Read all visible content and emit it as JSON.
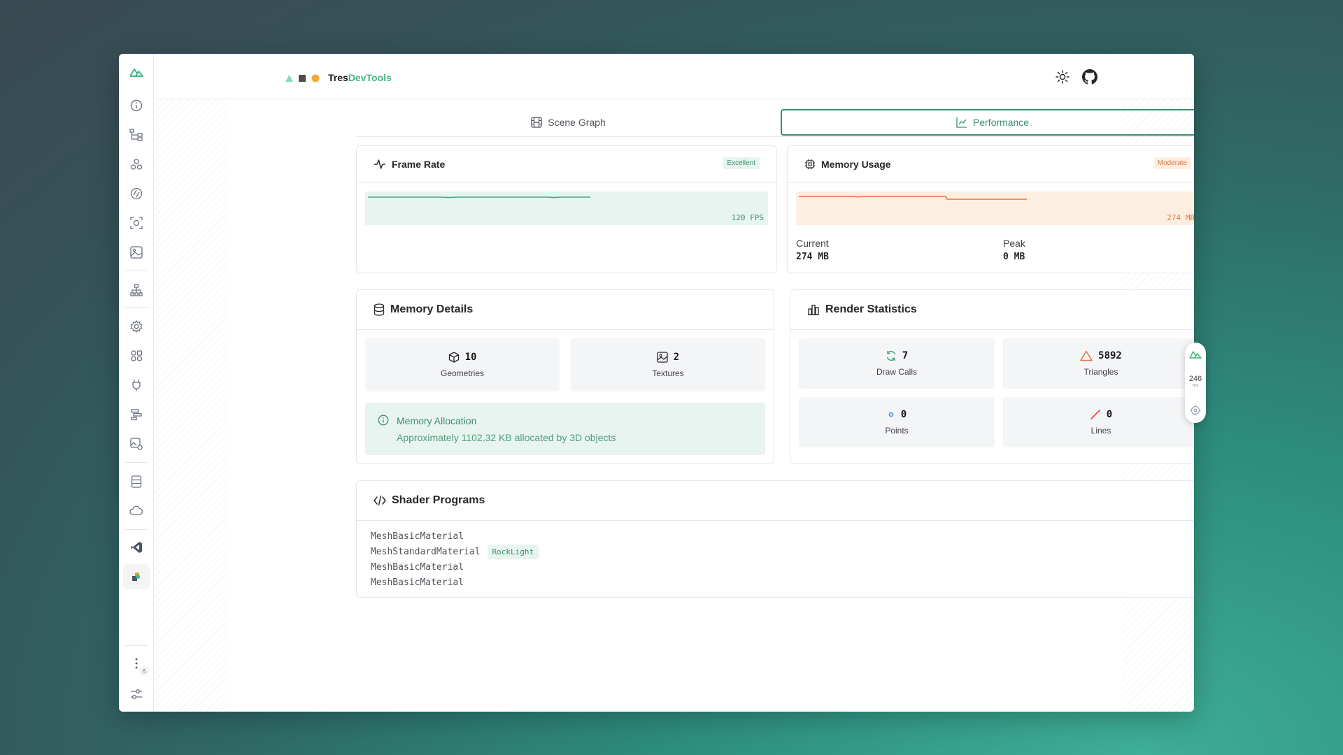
{
  "app": {
    "name_part1": "Tres",
    "name_part2": "DevTools",
    "accent_color": "#41b883"
  },
  "tabs": [
    {
      "label": "Scene Graph",
      "icon": "film-icon",
      "active": false
    },
    {
      "label": "Performance",
      "icon": "line-chart-icon",
      "active": true
    }
  ],
  "frame_rate": {
    "title": "Frame Rate",
    "status": "Excellent",
    "value_label": "120 FPS"
  },
  "memory_usage": {
    "title": "Memory Usage",
    "status": "Moderate",
    "value_label": "274 MB",
    "current_label": "Current",
    "current_value": "274 MB",
    "peak_label": "Peak",
    "peak_value": "0 MB"
  },
  "memory_details": {
    "title": "Memory Details",
    "geometries_value": "10",
    "geometries_label": "Geometries",
    "textures_value": "2",
    "textures_label": "Textures",
    "alloc_title": "Memory Allocation",
    "alloc_text": "Approximately 1102.32 KB allocated by 3D objects"
  },
  "render_stats": {
    "title": "Render Statistics",
    "draw_calls_value": "7",
    "draw_calls_label": "Draw Calls",
    "triangles_value": "5892",
    "triangles_label": "Triangles",
    "points_value": "0",
    "points_label": "Points",
    "lines_value": "0",
    "lines_label": "Lines"
  },
  "shaders": {
    "title": "Shader Programs",
    "items": [
      {
        "name": "MeshBasicMaterial",
        "tag": ""
      },
      {
        "name": "MeshStandardMaterial",
        "tag": "RockLight"
      },
      {
        "name": "MeshBasicMaterial",
        "tag": ""
      },
      {
        "name": "MeshBasicMaterial",
        "tag": ""
      }
    ]
  },
  "rail": {
    "more_count": "6"
  },
  "right_pill": {
    "value": "246",
    "unit": "ms"
  }
}
